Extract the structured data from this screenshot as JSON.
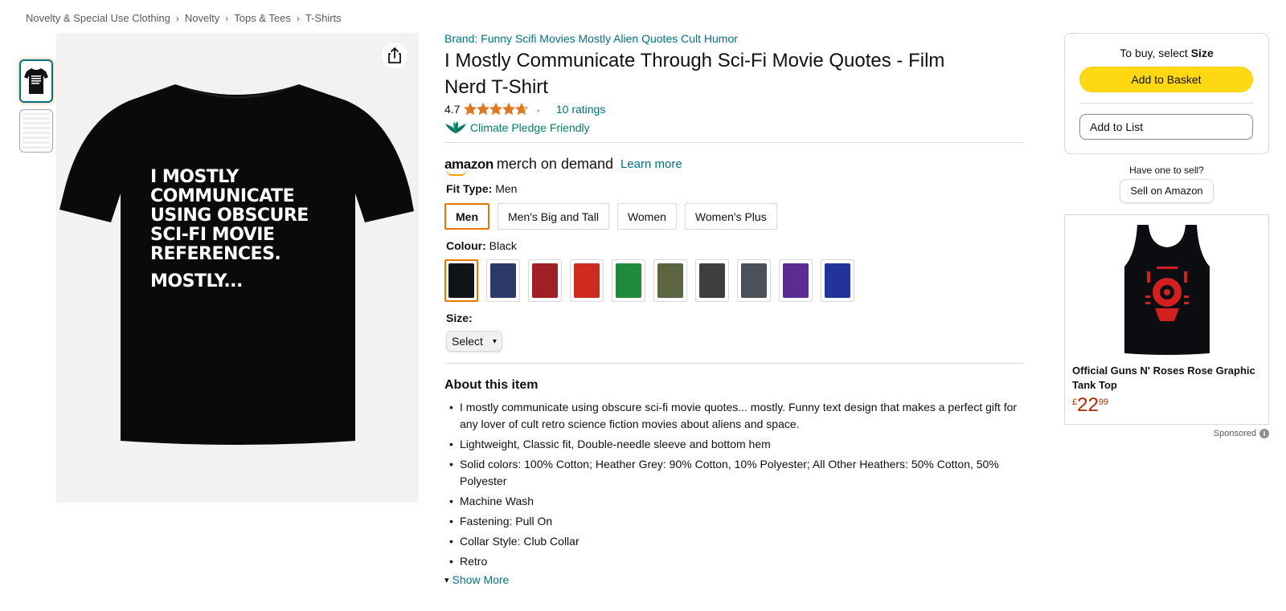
{
  "breadcrumb": [
    "Novelty & Special Use Clothing",
    "Novelty",
    "Tops & Tees",
    "T-Shirts"
  ],
  "breadcrumb_separator": "›",
  "product": {
    "brand_link": "Brand: Funny Scifi Movies Mostly Alien Quotes Cult Humor",
    "title": "I Mostly Communicate Through Sci-Fi Movie Quotes - Film Nerd T-Shirt",
    "rating": "4.7",
    "rating_stars_value": 4.7,
    "ratings_count": "10 ratings",
    "climate_pledge": "Climate Pledge Friendly",
    "image_text": {
      "lines": [
        "I MOSTLY",
        "COMMUNICATE",
        "USING OBSCURE",
        "SCI-FI MOVIE",
        "REFERENCES."
      ],
      "tagline": "MOSTLY..."
    }
  },
  "merch": {
    "logo_amazon": "amazon",
    "logo_rest": "merch on demand",
    "learn_more": "Learn more"
  },
  "fit": {
    "label": "Fit Type:",
    "selected": "Men",
    "options": [
      "Men",
      "Men's Big and Tall",
      "Women",
      "Women's Plus"
    ]
  },
  "colour": {
    "label": "Colour:",
    "selected": "Black",
    "swatches": [
      "#111416",
      "#2b3a66",
      "#9e1f24",
      "#cf2a20",
      "#1f8a3b",
      "#5b6640",
      "#3d3e40",
      "#4a515c",
      "#5b2d91",
      "#22339c"
    ]
  },
  "size": {
    "label": "Size:",
    "select_value": "Select"
  },
  "about": {
    "title": "About this item",
    "bullets": [
      "I mostly communicate using obscure sci-fi movie quotes... mostly. Funny text design that makes a perfect gift for any lover of cult retro science fiction movies about aliens and space.",
      "Lightweight, Classic fit, Double-needle sleeve and bottom hem",
      "Solid colors: 100% Cotton; Heather Grey: 90% Cotton, 10% Polyester; All Other Heathers: 50% Cotton, 50% Polyester",
      "Machine Wash",
      "Fastening: Pull On",
      "Collar Style: Club Collar",
      "Retro"
    ],
    "show_more": "Show More"
  },
  "buybox": {
    "prompt_prefix": "To buy, select",
    "prompt_bold": "Size",
    "add_to_basket": "Add to Basket",
    "add_to_list": "Add to List"
  },
  "sell": {
    "question": "Have one to sell?",
    "button": "Sell on Amazon"
  },
  "ad": {
    "title": "Official Guns N' Roses Rose Graphic Tank Top",
    "currency": "£",
    "price_whole": "22",
    "price_fraction": "99",
    "sponsored": "Sponsored",
    "info_glyph": "i"
  },
  "colors": {
    "link": "#007185",
    "basket_button": "#ffd814",
    "selected_border": "#e77600",
    "price": "#b12704",
    "star": "#de7921",
    "climate_green": "#067d62"
  }
}
